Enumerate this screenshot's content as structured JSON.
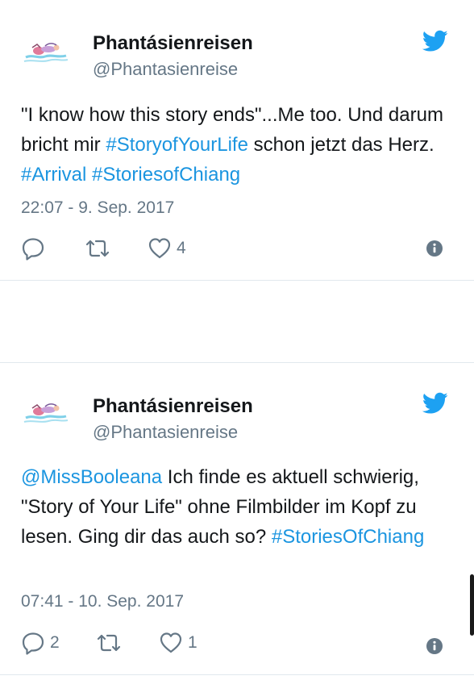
{
  "tweets": [
    {
      "display_name": "Phantásienreisen",
      "handle": "@Phantasienreise",
      "text_parts": [
        {
          "t": "\"I know how this story ends\"...Me too. Und darum bricht mir ",
          "link": false
        },
        {
          "t": "#StoryofYourLife",
          "link": true
        },
        {
          "t": " schon jetzt das Herz. ",
          "link": false
        },
        {
          "t": "#Arrival",
          "link": true
        },
        {
          "t": " ",
          "link": false
        },
        {
          "t": "#StoriesofChiang",
          "link": true
        }
      ],
      "timestamp": "22:07 - 9. Sep. 2017",
      "reply_count": "",
      "retweet_count": "",
      "like_count": "4"
    },
    {
      "display_name": "Phantásienreisen",
      "handle": "@Phantasienreise",
      "text_parts": [
        {
          "t": "@MissBooleana",
          "link": true
        },
        {
          "t": " Ich finde es aktuell schwierig, \"Story of Your Life\" ohne Filmbilder im Kopf zu lesen. Ging dir das auch so? ",
          "link": false
        },
        {
          "t": "#StoriesOfChiang",
          "link": true
        }
      ],
      "timestamp": "07:41 - 10. Sep. 2017",
      "reply_count": "2",
      "retweet_count": "",
      "like_count": "1"
    }
  ],
  "icons": {
    "brand": "twitter-bird-icon",
    "reply": "reply-icon",
    "retweet": "retweet-icon",
    "like": "heart-icon",
    "info": "info-icon"
  },
  "colors": {
    "link": "#1b95e0",
    "twitter_blue": "#1da1f2",
    "muted": "#657786",
    "divider": "#e1e8ed"
  }
}
